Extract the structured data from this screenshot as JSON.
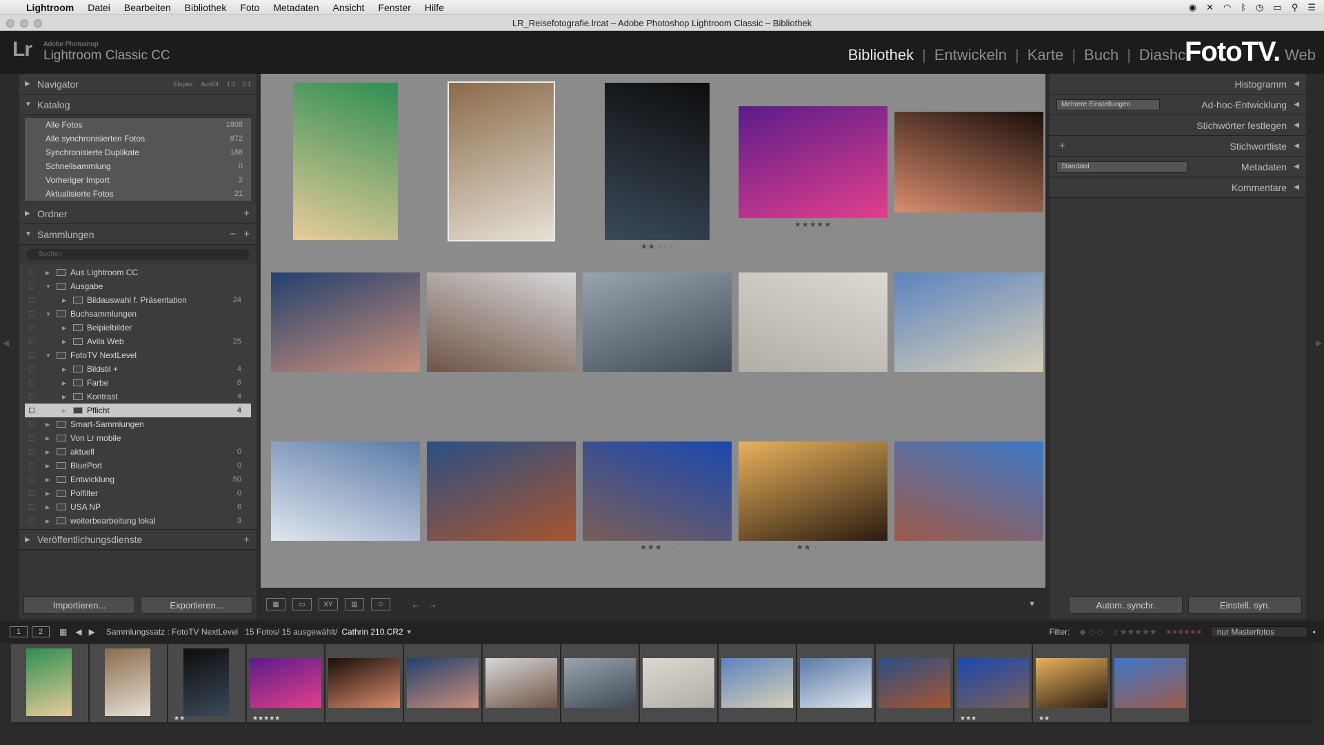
{
  "menubar": {
    "app": "Lightroom",
    "items": [
      "Datei",
      "Bearbeiten",
      "Bibliothek",
      "Foto",
      "Metadaten",
      "Ansicht",
      "Fenster",
      "Hilfe"
    ]
  },
  "window": {
    "title": "LR_Reisefotografie.lrcat – Adobe Photoshop Lightroom Classic – Bibliothek"
  },
  "brand": {
    "lr": "Lr",
    "adobe": "Adobe Photoshop",
    "product": "Lightroom Classic CC",
    "overlay": "FotoTV."
  },
  "modules": [
    "Bibliothek",
    "Entwickeln",
    "Karte",
    "Buch",
    "Diashc",
    "Web"
  ],
  "left": {
    "navigator": {
      "title": "Navigator",
      "opts": [
        "Einpas.",
        "Ausfül.",
        "1:1",
        "2:1"
      ]
    },
    "katalog": {
      "title": "Katalog",
      "items": [
        {
          "label": "Alle Fotos",
          "count": "1808"
        },
        {
          "label": "Alle synchronisierten Fotos",
          "count": "872"
        },
        {
          "label": "Synchronisierte Duplikate",
          "count": "188"
        },
        {
          "label": "Schnellsammlung",
          "count": "0"
        },
        {
          "label": "Vorheriger Import",
          "count": "2"
        },
        {
          "label": "Aktualisierte Fotos",
          "count": "21"
        }
      ]
    },
    "ordner": {
      "title": "Ordner"
    },
    "sammlungen": {
      "title": "Sammlungen",
      "search_placeholder": "Suchen",
      "rows": [
        {
          "label": "Aus Lightroom CC",
          "count": "",
          "level": 0
        },
        {
          "label": "Ausgabe",
          "count": "",
          "level": 0
        },
        {
          "label": "Bildauswahl f. Präsentation",
          "count": "24",
          "level": 1
        },
        {
          "label": "Buchsammlungen",
          "count": "",
          "level": 0
        },
        {
          "label": "Beipielbilder",
          "count": "",
          "level": 1
        },
        {
          "label": "Avila Web",
          "count": "25",
          "level": 1
        },
        {
          "label": "FotoTV NextLevel",
          "count": "",
          "level": 0
        },
        {
          "label": "Bildstil +",
          "count": "4",
          "level": 1
        },
        {
          "label": "Farbe",
          "count": "6",
          "level": 1
        },
        {
          "label": "Kontrast",
          "count": "4",
          "level": 1
        },
        {
          "label": "Pflicht",
          "count": "4",
          "level": 1
        },
        {
          "label": "Smart-Sammlungen",
          "count": "",
          "level": 0
        },
        {
          "label": "Von Lr mobile",
          "count": "",
          "level": 0
        },
        {
          "label": "aktuell",
          "count": "0",
          "level": 0
        },
        {
          "label": "BluePort",
          "count": "0",
          "level": 0
        },
        {
          "label": "Entwicklung",
          "count": "50",
          "level": 0
        },
        {
          "label": "Polfilter",
          "count": "0",
          "level": 0
        },
        {
          "label": "USA NP",
          "count": "6",
          "level": 0
        },
        {
          "label": "weiterbearbeitung lokal",
          "count": "3",
          "level": 0
        }
      ]
    },
    "veroeff": {
      "title": "Veröffentlichungsdienste"
    },
    "import_label": "Importieren...",
    "export_label": "Exportieren..."
  },
  "right": {
    "histogramm": "Histogramm",
    "adhoc": "Ad-hoc-Entwicklung",
    "adhoc_select": "Mehrere Einstellungen",
    "stichwoerter": "Stichwörter festlegen",
    "stichwortliste": "Stichwortliste",
    "metadaten": "Metadaten",
    "metadaten_select": "Standard",
    "kommentare": "Kommentare",
    "sync_auto": "Autom. synchr.",
    "sync_settings": "Einstell. syn."
  },
  "grid": {
    "photos": [
      {
        "colors": [
          "#2e8f52",
          "#e7cc9a"
        ],
        "stars": ""
      },
      {
        "colors": [
          "#8b6b4a",
          "#e6e1d6"
        ],
        "stars": ""
      },
      {
        "colors": [
          "#0d0d0d",
          "#3b4a5a"
        ],
        "stars": "★★ · · ·"
      },
      {
        "colors": [
          "#5b1c8a",
          "#e23f8c"
        ],
        "stars": "★★★★★"
      },
      {
        "colors": [
          "#1a0e0a",
          "#d98d6e"
        ],
        "stars": ""
      },
      {
        "colors": [
          "#23406e",
          "#c98f7a"
        ],
        "stars": ""
      },
      {
        "colors": [
          "#d7d7d9",
          "#6f5445"
        ],
        "stars": ""
      },
      {
        "colors": [
          "#9aa4ae",
          "#3f4a55"
        ],
        "stars": ""
      },
      {
        "colors": [
          "#dcd8d2",
          "#b2aea6"
        ],
        "stars": ""
      },
      {
        "colors": [
          "#5b84c0",
          "#d8cfb8"
        ],
        "stars": ""
      },
      {
        "colors": [
          "#5b7aa8",
          "#e0e6ee"
        ],
        "stars": ""
      },
      {
        "colors": [
          "#2a4f85",
          "#a7552f"
        ],
        "stars": ""
      },
      {
        "colors": [
          "#1a48b0",
          "#7a5e58"
        ],
        "stars": "★★★ · ·"
      },
      {
        "colors": [
          "#e9b25c",
          "#2a1b10"
        ],
        "stars": "★★ · · ·"
      },
      {
        "colors": [
          "#3d78c8",
          "#9e5a4a"
        ],
        "stars": ""
      }
    ]
  },
  "filmbar": {
    "page1": "1",
    "page2": "2",
    "source": "Sammlungssatz : FotoTV NextLevel",
    "count": "15 Fotos/ 15 ausgewählt/",
    "file": "Cathrin 210.CR2",
    "filter_label": "Filter:",
    "filter_stars": "≥ ★★★★★",
    "master": "nur Masterfotos"
  },
  "filmstrip": {
    "stars": [
      "",
      "",
      "★★",
      "★★★★★",
      "",
      "",
      "",
      "",
      "",
      "",
      "",
      "",
      "★★★",
      "★★",
      ""
    ]
  }
}
